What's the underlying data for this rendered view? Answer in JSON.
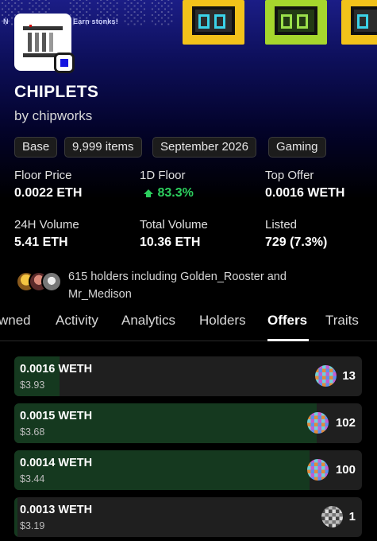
{
  "banner": {
    "text_left": "N",
    "text_right": "Earn stonks!"
  },
  "collection": {
    "name": "CHIPLETS",
    "creator": "by chipworks",
    "tags": [
      "Base",
      "9,999 items",
      "September 2026",
      "Gaming"
    ]
  },
  "stats": [
    {
      "label": "Floor Price",
      "value": "0.0022 ETH"
    },
    {
      "label": "1D Floor",
      "value": "83.3%",
      "trend": "up"
    },
    {
      "label": "Top Offer",
      "value": "0.0016 WETH"
    },
    {
      "label": "24H Volume",
      "value": "5.41 ETH"
    },
    {
      "label": "Total Volume",
      "value": "10.36 ETH"
    },
    {
      "label": "Listed",
      "value": "729 (7.3%)"
    }
  ],
  "holders": {
    "text": "615 holders including Golden_Rooster and Mr_Medison"
  },
  "tabs": [
    "wned",
    "Activity",
    "Analytics",
    "Holders",
    "Offers",
    "Traits"
  ],
  "active_tab": "Offers",
  "offers": [
    {
      "price": "0.0016 WETH",
      "usd": "$3.93",
      "qty": "13",
      "icon": "pixel-avatar-icon",
      "depth": 0.13
    },
    {
      "price": "0.0015 WETH",
      "usd": "$3.68",
      "qty": "102",
      "icon": "pixel-avatar-icon",
      "depth": 0.87
    },
    {
      "price": "0.0014 WETH",
      "usd": "$3.44",
      "qty": "100",
      "icon": "pixel-avatar-icon",
      "depth": 0.85
    },
    {
      "price": "0.0013 WETH",
      "usd": "$3.19",
      "qty": "1",
      "icon": "user-avatar-icon",
      "depth": 0.01
    }
  ],
  "colors": {
    "accent_green": "#2ccf5e",
    "offer_fill": "#15391f",
    "verify_blue": "#1515e0"
  }
}
